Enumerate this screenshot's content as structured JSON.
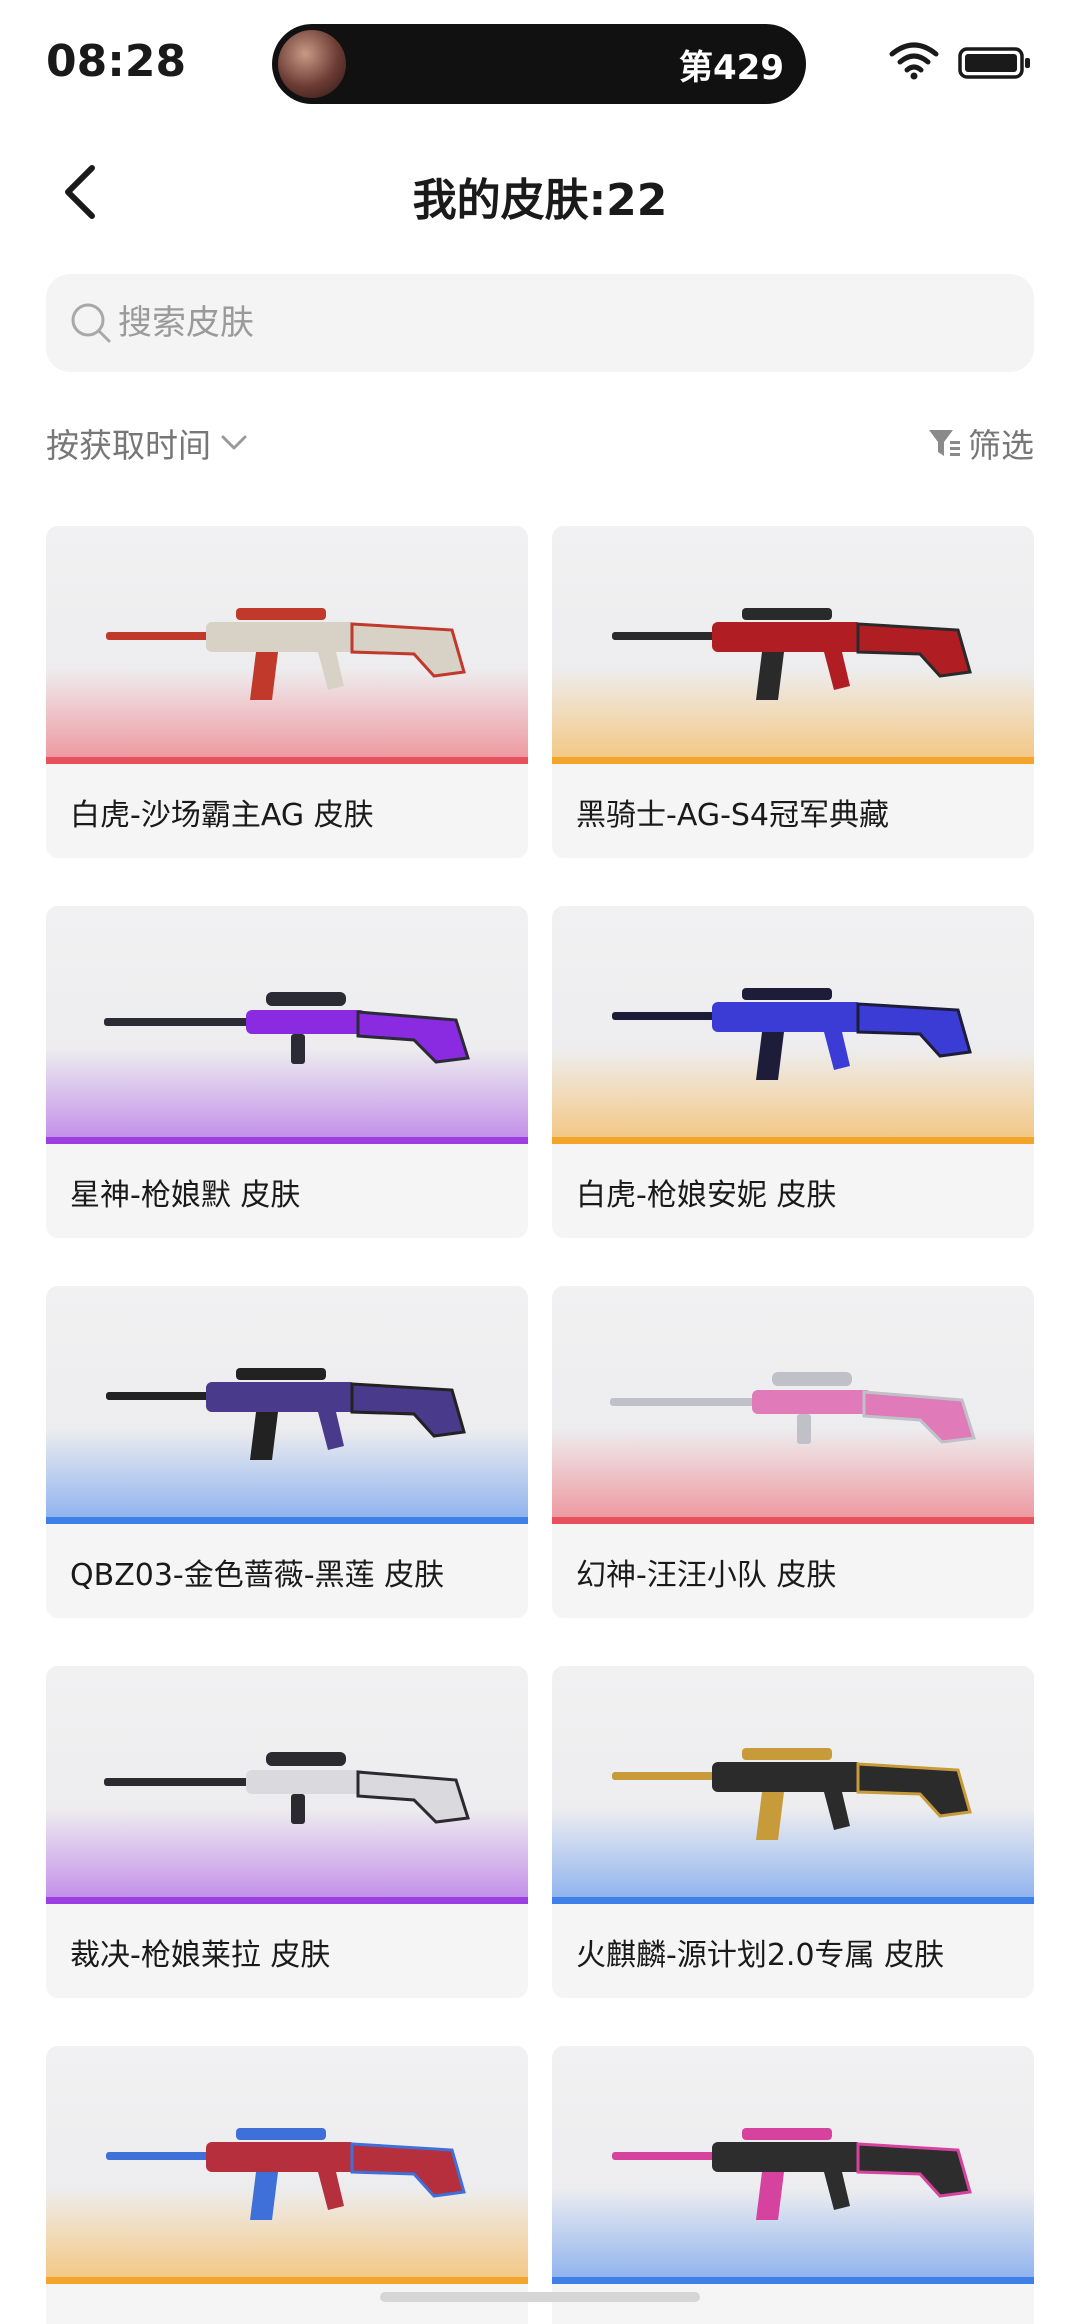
{
  "status_bar": {
    "time": "08:28",
    "island_text": "第429"
  },
  "header": {
    "title": "我的皮肤:22",
    "back_icon": "chevron-left-icon"
  },
  "search": {
    "value": "",
    "placeholder": "搜索皮肤"
  },
  "toolbar": {
    "sort_label": "按获取时间",
    "filter_label": "筛选"
  },
  "skins": [
    {
      "name": "白虎-沙场霸主AG 皮肤",
      "rarity_color": "#e8505b",
      "gun_main": "#d8d2c6",
      "gun_accent": "#c0392b"
    },
    {
      "name": "黑骑士-AG-S4冠军典藏",
      "rarity_color": "#f3a42a",
      "gun_main": "#b01e24",
      "gun_accent": "#2a2a2a"
    },
    {
      "name": "星神-枪娘默 皮肤",
      "rarity_color": "#9b3fe0",
      "gun_main": "#8a2be2",
      "gun_accent": "#2b2b35"
    },
    {
      "name": "白虎-枪娘安妮 皮肤",
      "rarity_color": "#f3a42a",
      "gun_main": "#3b3bd6",
      "gun_accent": "#1d1d3a"
    },
    {
      "name": "QBZ03-金色蔷薇-黑莲 皮肤",
      "rarity_color": "#3f7fe8",
      "gun_main": "#4a3a8c",
      "gun_accent": "#222"
    },
    {
      "name": "幻神-汪汪小队 皮肤",
      "rarity_color": "#e8505b",
      "gun_main": "#e07ab8",
      "gun_accent": "#c0c0c8"
    },
    {
      "name": "裁决-枪娘莱拉 皮肤",
      "rarity_color": "#9b3fe0",
      "gun_main": "#d9d9de",
      "gun_accent": "#2a2a30"
    },
    {
      "name": "火麒麟-源计划2.0专属 皮肤",
      "rarity_color": "#3f7fe8",
      "gun_main": "#2b2b2b",
      "gun_accent": "#c79a3a"
    },
    {
      "name": "",
      "rarity_color": "#f3a42a",
      "gun_main": "#b52f3c",
      "gun_accent": "#3f6fd8"
    },
    {
      "name": "",
      "rarity_color": "#3f7fe8",
      "gun_main": "#2d2d2d",
      "gun_accent": "#d6439e"
    }
  ]
}
